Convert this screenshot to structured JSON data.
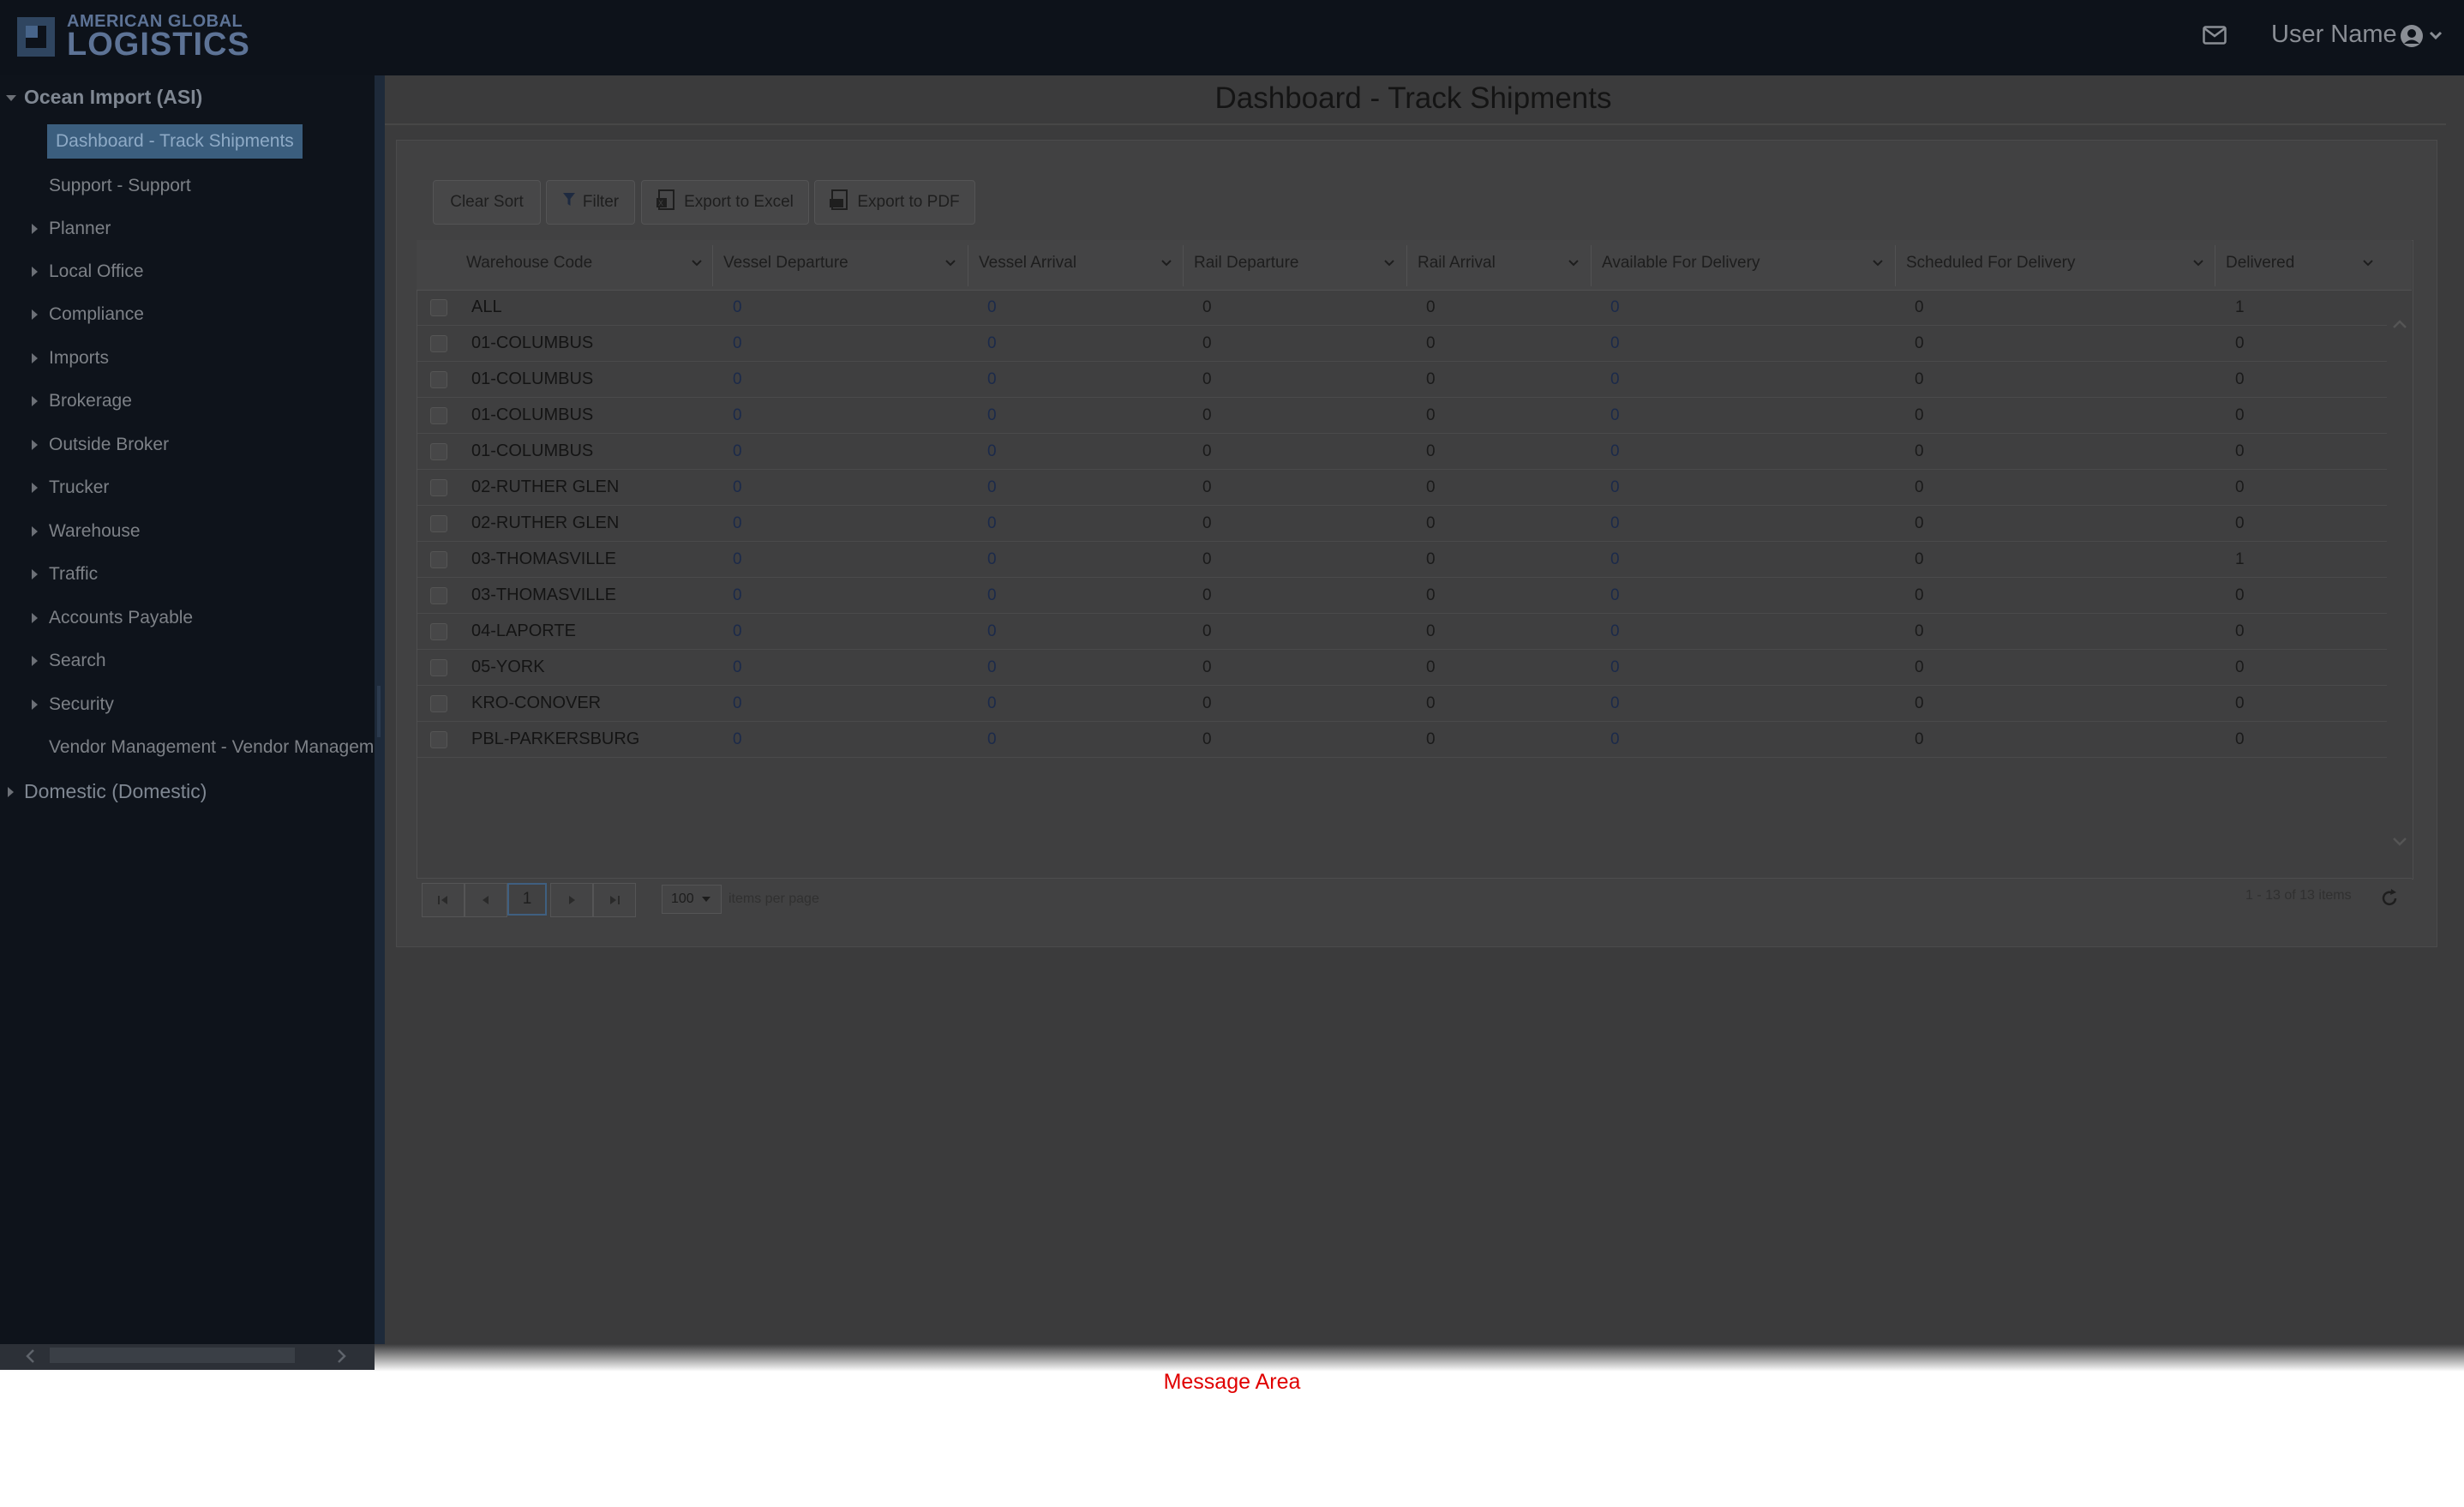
{
  "header": {
    "logo_line1": "AMERICAN GLOBAL",
    "logo_line2": "LOGISTICS",
    "mail_icon": "envelope-icon",
    "user_name": "User Name",
    "user_icon": "user-circle-icon",
    "user_chevron": "chevron-down-icon"
  },
  "sidebar": {
    "sections": [
      {
        "label": "Ocean Import (ASI)",
        "expanded": true
      },
      {
        "label": "Domestic (Domestic)",
        "expanded": false
      }
    ],
    "items": [
      {
        "label": "Dashboard - Track Shipments",
        "active": true,
        "expandable": false
      },
      {
        "label": "Support - Support",
        "expandable": false
      },
      {
        "label": "Planner",
        "expandable": true
      },
      {
        "label": "Local Office",
        "expandable": true
      },
      {
        "label": "Compliance",
        "expandable": true
      },
      {
        "label": "Imports",
        "expandable": true
      },
      {
        "label": "Brokerage",
        "expandable": true
      },
      {
        "label": "Outside Broker",
        "expandable": true
      },
      {
        "label": "Trucker",
        "expandable": true
      },
      {
        "label": "Warehouse",
        "expandable": true
      },
      {
        "label": "Traffic",
        "expandable": true
      },
      {
        "label": "Accounts Payable",
        "expandable": true
      },
      {
        "label": "Search",
        "expandable": true
      },
      {
        "label": "Security",
        "expandable": true
      },
      {
        "label": "Vendor Management - Vendor Managem",
        "expandable": false
      }
    ]
  },
  "main": {
    "page_title": "Dashboard - Track Shipments",
    "toolbar": {
      "clear_sort": "Clear Sort",
      "filter": "Filter",
      "export_excel": "Export to Excel",
      "export_pdf": "Export to PDF"
    },
    "grid": {
      "columns": [
        "Warehouse Code",
        "Vessel Departure",
        "Vessel Arrival",
        "Rail Departure",
        "Rail Arrival",
        "Available For Delivery",
        "Scheduled For Delivery",
        "Delivered"
      ],
      "rows": [
        [
          "ALL",
          "0",
          "0",
          "0",
          "0",
          "0",
          "0",
          "1"
        ],
        [
          "01-COLUMBUS",
          "0",
          "0",
          "0",
          "0",
          "0",
          "0",
          "0"
        ],
        [
          "01-COLUMBUS",
          "0",
          "0",
          "0",
          "0",
          "0",
          "0",
          "0"
        ],
        [
          "01-COLUMBUS",
          "0",
          "0",
          "0",
          "0",
          "0",
          "0",
          "0"
        ],
        [
          "01-COLUMBUS",
          "0",
          "0",
          "0",
          "0",
          "0",
          "0",
          "0"
        ],
        [
          "02-RUTHER GLEN",
          "0",
          "0",
          "0",
          "0",
          "0",
          "0",
          "0"
        ],
        [
          "02-RUTHER GLEN",
          "0",
          "0",
          "0",
          "0",
          "0",
          "0",
          "0"
        ],
        [
          "03-THOMASVILLE",
          "0",
          "0",
          "0",
          "0",
          "0",
          "0",
          "1"
        ],
        [
          "03-THOMASVILLE",
          "0",
          "0",
          "0",
          "0",
          "0",
          "0",
          "0"
        ],
        [
          "04-LAPORTE",
          "0",
          "0",
          "0",
          "0",
          "0",
          "0",
          "0"
        ],
        [
          "05-YORK",
          "0",
          "0",
          "0",
          "0",
          "0",
          "0",
          "0"
        ],
        [
          "KRO-CONOVER",
          "0",
          "0",
          "0",
          "0",
          "0",
          "0",
          "0"
        ],
        [
          "PBL-PARKERSBURG",
          "0",
          "0",
          "0",
          "0",
          "0",
          "0",
          "0"
        ]
      ]
    },
    "pager": {
      "current_page": "1",
      "page_size": "100",
      "page_size_label": "items per page",
      "info": "1 - 13 of 13 items"
    }
  },
  "footer": {
    "message_area": "Message Area"
  }
}
